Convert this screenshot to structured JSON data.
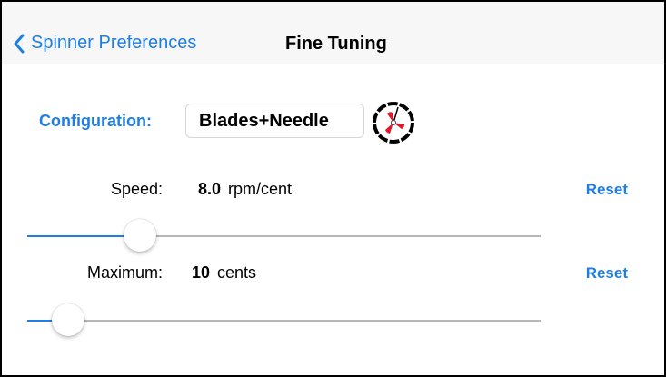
{
  "nav": {
    "back_label": "Spinner Preferences",
    "title": "Fine Tuning",
    "back_icon": "chevron-left-icon"
  },
  "configuration": {
    "label": "Configuration:",
    "value": "Blades+Needle",
    "icon": "spinner-icon"
  },
  "speed": {
    "label": "Speed:",
    "value": "8.0",
    "unit": "rpm/cent",
    "reset_label": "Reset",
    "slider_fraction": 0.22
  },
  "maximum": {
    "label": "Maximum:",
    "value": "10",
    "unit": "cents",
    "reset_label": "Reset",
    "slider_fraction": 0.08
  },
  "colors": {
    "accent": "#1f7ee5",
    "spinner_blade": "#e0182a"
  }
}
